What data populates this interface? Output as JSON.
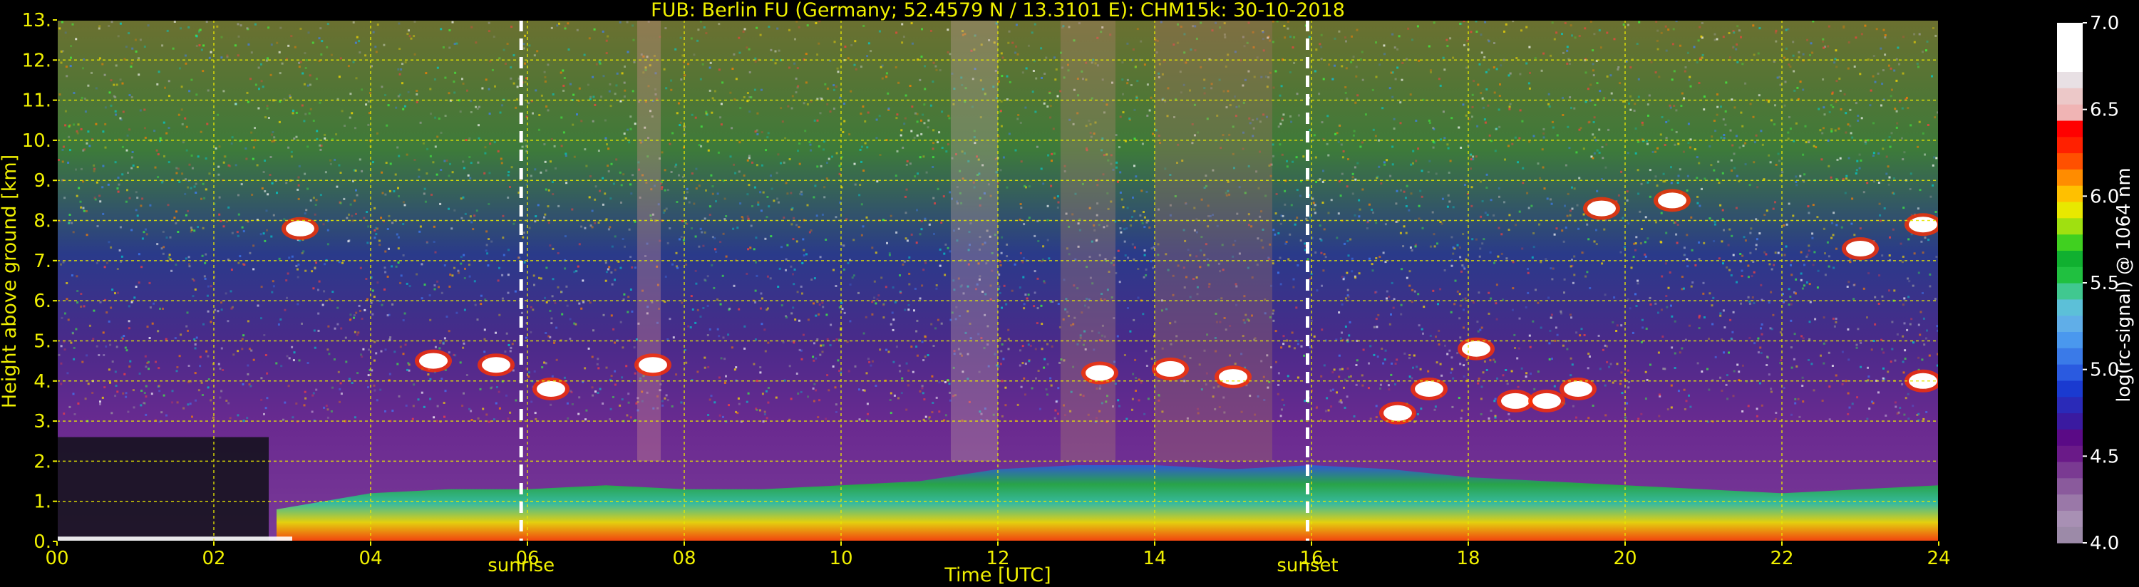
{
  "chart_data": {
    "type": "heatmap",
    "title": "FUB: Berlin FU (Germany; 52.4579 N / 13.3101 E):    CHM15k: 30-10-2018",
    "xlabel": "Time [UTC]",
    "ylabel": "Height above ground [km]",
    "xlim": [
      0,
      24
    ],
    "ylim": [
      0,
      13
    ],
    "x_ticks": [
      "00",
      "02",
      "04",
      "06",
      "08",
      "10",
      "12",
      "14",
      "16",
      "18",
      "20",
      "22",
      "24"
    ],
    "y_ticks": [
      "0.",
      "1.",
      "2.",
      "3.",
      "4.",
      "5.",
      "6.",
      "7.",
      "8.",
      "9.",
      "10.",
      "11.",
      "12.",
      "13."
    ],
    "grid": true,
    "markers": [
      {
        "label": "sunrise",
        "time_utc": 5.92
      },
      {
        "label": "sunset",
        "time_utc": 15.95
      }
    ],
    "colorbar": {
      "label": "log(rc-signal) @ 1064 nm",
      "range": [
        4.0,
        7.0
      ],
      "ticks": [
        "4.0",
        "4.5",
        "5.0",
        "5.5",
        "6.0",
        "6.5",
        "7.0"
      ],
      "colors": [
        "#9c8aa8",
        "#a890b4",
        "#9a78a8",
        "#8a5a9c",
        "#7a3a92",
        "#6a1a88",
        "#5a0a86",
        "#3a1aa0",
        "#2a2ab8",
        "#1a3ad0",
        "#2a5ae0",
        "#3a7ae8",
        "#4a98ee",
        "#60aee8",
        "#5cc0d8",
        "#40c890",
        "#20c040",
        "#10b030",
        "#40d020",
        "#a0e010",
        "#e8e800",
        "#ffc000",
        "#ff8c00",
        "#ff5000",
        "#ff2000",
        "#ff0000",
        "#f0b4b4",
        "#ecc8c8",
        "#e8e0e4",
        "#ffffff",
        "#ffffff",
        "#ffffff"
      ]
    },
    "series": [
      {
        "name": "Planetary boundary layer top",
        "x": [
          2.8,
          4,
          5,
          6,
          7,
          8,
          9,
          10,
          11,
          12,
          13,
          14,
          15,
          16,
          17,
          18,
          19,
          20,
          21,
          22,
          23,
          24
        ],
        "y": [
          0.8,
          1.2,
          1.3,
          1.3,
          1.4,
          1.3,
          1.3,
          1.4,
          1.5,
          1.8,
          1.9,
          1.9,
          1.8,
          1.9,
          1.8,
          1.6,
          1.5,
          1.4,
          1.3,
          1.2,
          1.3,
          1.4
        ]
      },
      {
        "name": "Cloud layers",
        "x": [
          3.1,
          4.8,
          5.6,
          6.3,
          7.6,
          13.3,
          14.2,
          15.0,
          17.1,
          17.5,
          18.1,
          18.6,
          19.0,
          19.4,
          19.7,
          20.6,
          23.0,
          23.8,
          23.8
        ],
        "y": [
          7.8,
          4.5,
          4.4,
          3.8,
          4.4,
          4.2,
          4.3,
          4.1,
          3.2,
          3.8,
          4.8,
          3.5,
          3.5,
          3.8,
          8.3,
          8.5,
          7.3,
          7.9,
          4.0
        ]
      }
    ]
  }
}
